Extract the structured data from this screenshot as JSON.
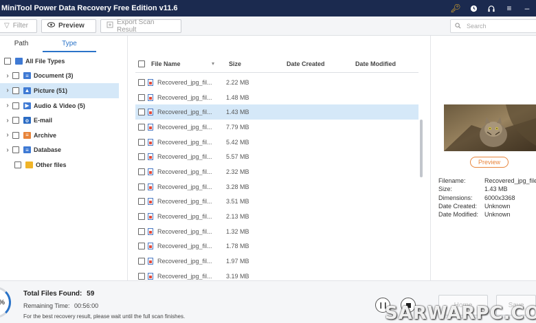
{
  "window": {
    "title": "MiniTool Power Data Recovery Free Edition v11.6"
  },
  "toolbar": {
    "filter_label": "Filter",
    "preview_label": "Preview",
    "export_label": "Export Scan Result",
    "search_placeholder": "Search"
  },
  "left": {
    "tabs": [
      {
        "label": "Path",
        "active": false
      },
      {
        "label": "Type",
        "active": true
      }
    ],
    "tree": [
      {
        "label": "All File Types",
        "icon": "monitor-icon",
        "color": "#3f7ad4"
      },
      {
        "label": "Document (3)",
        "icon": "document-icon",
        "color": "#3f7ad4"
      },
      {
        "label": "Picture (51)",
        "icon": "picture-icon",
        "color": "#3f7ad4",
        "selected": true
      },
      {
        "label": "Audio & Video (5)",
        "icon": "media-icon",
        "color": "#3f7ad4"
      },
      {
        "label": "E-mail",
        "icon": "email-icon",
        "color": "#2b6cc4"
      },
      {
        "label": "Archive",
        "icon": "archive-icon",
        "color": "#e8843a"
      },
      {
        "label": "Database",
        "icon": "database-icon",
        "color": "#3f7ad4"
      },
      {
        "label": "Other files",
        "icon": "other-files-icon",
        "color": "#f0b428"
      }
    ]
  },
  "list": {
    "columns": [
      "File Name",
      "Size",
      "Date Created",
      "Date Modified"
    ],
    "rows": [
      {
        "name": "Recovered_jpg_fil...",
        "size": "2.22 MB"
      },
      {
        "name": "Recovered_jpg_fil...",
        "size": "1.48 MB"
      },
      {
        "name": "Recovered_jpg_fil...",
        "size": "1.43 MB",
        "selected": true
      },
      {
        "name": "Recovered_jpg_fil...",
        "size": "7.79 MB"
      },
      {
        "name": "Recovered_jpg_fil...",
        "size": "5.42 MB"
      },
      {
        "name": "Recovered_jpg_fil...",
        "size": "5.57 MB"
      },
      {
        "name": "Recovered_jpg_fil...",
        "size": "2.32 MB"
      },
      {
        "name": "Recovered_jpg_fil...",
        "size": "3.28 MB"
      },
      {
        "name": "Recovered_jpg_fil...",
        "size": "3.51 MB"
      },
      {
        "name": "Recovered_jpg_fil...",
        "size": "2.13 MB"
      },
      {
        "name": "Recovered_jpg_fil...",
        "size": "1.32 MB"
      },
      {
        "name": "Recovered_jpg_fil...",
        "size": "1.78 MB"
      },
      {
        "name": "Recovered_jpg_fil...",
        "size": "1.97 MB"
      },
      {
        "name": "Recovered_jpg_fil...",
        "size": "3.19 MB"
      }
    ]
  },
  "preview": {
    "button_label": "Preview",
    "props": [
      {
        "key": "Filename:",
        "value": "Recovered_jpg_file"
      },
      {
        "key": "Size:",
        "value": "1.43 MB"
      },
      {
        "key": "Dimensions:",
        "value": "6000x3368"
      },
      {
        "key": "Date Created:",
        "value": "Unknown"
      },
      {
        "key": "Date Modified:",
        "value": "Unknown"
      }
    ]
  },
  "status": {
    "progress_text": "%",
    "total_label": "Total Files Found:",
    "total_value": "59",
    "remaining_label": "Remaining Time:",
    "remaining_value": "00:56:00",
    "hint": "For the best recovery result, please wait until the full scan finishes.",
    "home_label": "Home",
    "save_label": "Save",
    "watermark": "SARWARPC.CO"
  },
  "colors": {
    "titlebar": "#1b2a4f",
    "accent": "#2a73c8",
    "selection": "#d5e8f8",
    "preview_button": "#e8843a"
  }
}
